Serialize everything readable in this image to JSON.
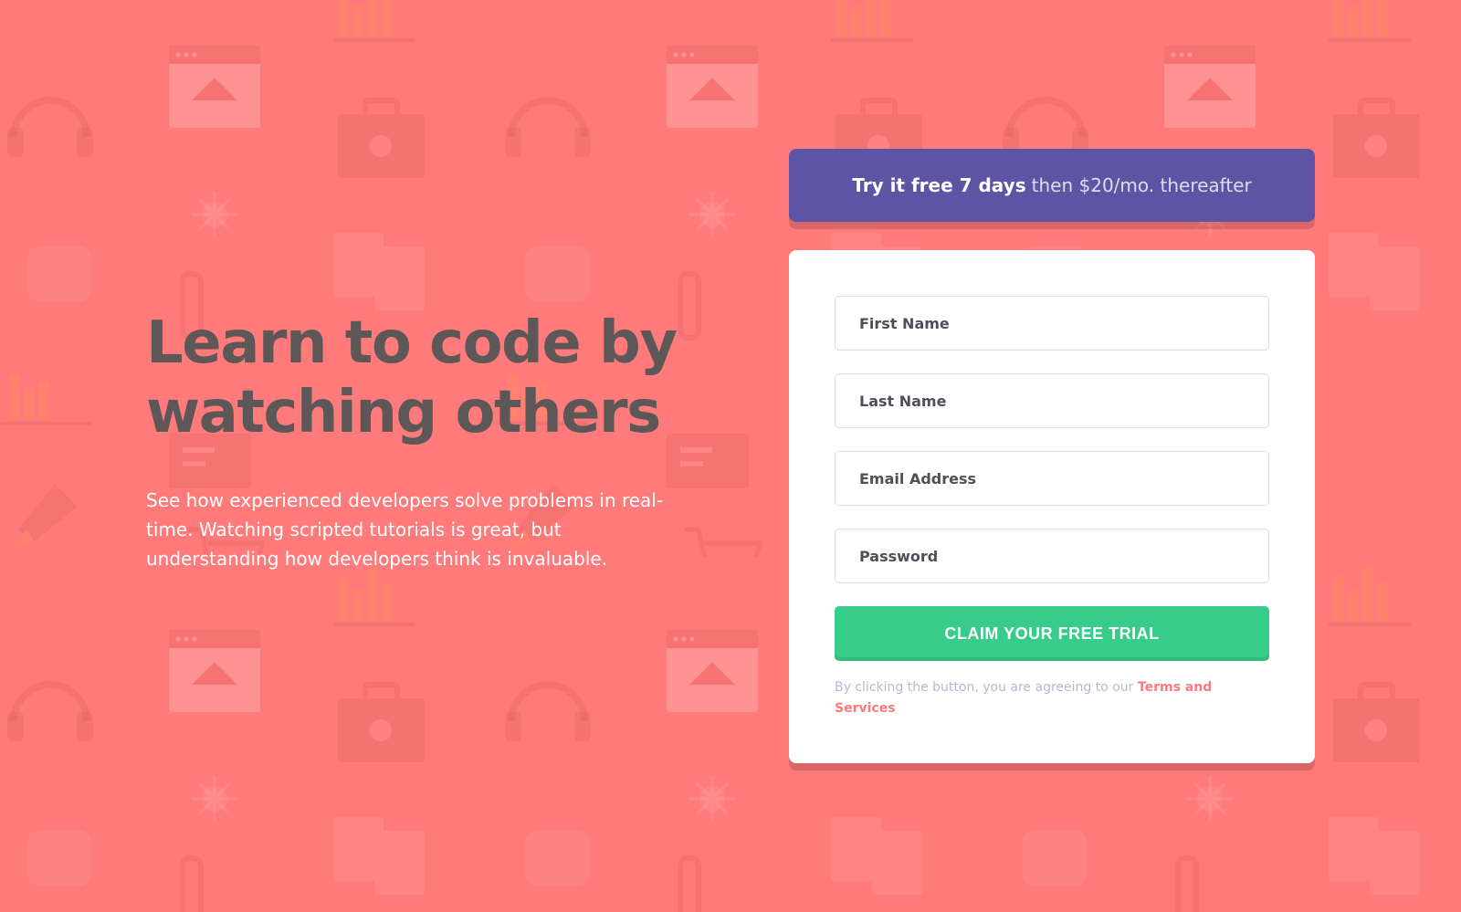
{
  "hero": {
    "heading_line1": "Learn to code by",
    "heading_line2": "watching others",
    "description": "See how experienced developers solve problems in real-time. Watching scripted tutorials is great, but understanding how developers think is invaluable."
  },
  "promo": {
    "bold_text": "Try it free 7 days",
    "rest_text": "then $20/mo. thereafter"
  },
  "form": {
    "first_name_placeholder": "First Name",
    "last_name_placeholder": "Last Name",
    "email_placeholder": "Email Address",
    "password_placeholder": "Password",
    "submit_label": "CLAIM YOUR FREE TRIAL",
    "terms_prefix": "By clicking the button, you are agreeing to our ",
    "terms_link": "Terms and Services"
  },
  "colors": {
    "background": "#FF7A7A",
    "promo": "#5E54A4",
    "button": "#38CC8B",
    "heading": "#5E5757",
    "link": "#FF7979"
  }
}
